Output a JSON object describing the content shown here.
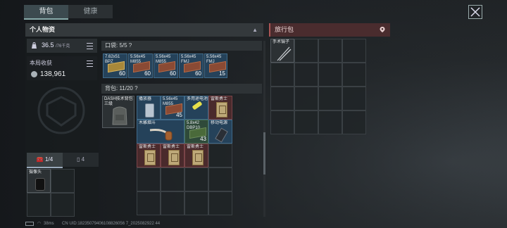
{
  "tabs": {
    "backpack": "背包",
    "health": "健康"
  },
  "personal": {
    "title": "个人物资"
  },
  "travel": {
    "title": "旅行包",
    "items": [
      {
        "label": "手术镊子"
      }
    ]
  },
  "weight": {
    "value": "36.5",
    "max": "/76千克"
  },
  "earnings": {
    "label": "本局收获",
    "value": "138,961"
  },
  "pocket": {
    "title": "口袋: 5/5  ?",
    "items": [
      {
        "label": "7.62x51\nBPZ",
        "count": "60"
      },
      {
        "label": "5.56x45\nM855",
        "count": "60"
      },
      {
        "label": "5.56x45\nM855",
        "count": "60"
      },
      {
        "label": "5.56x45\nFMJ",
        "count": "60"
      },
      {
        "label": "5.56x45\nFMJ",
        "count": "15"
      }
    ]
  },
  "backpack": {
    "title": "背包: 11/20  ?",
    "bag_label": "DASH技术背包\n三级",
    "items": [
      {
        "label": "播放器"
      },
      {
        "label": "5.56x45\nM855",
        "count": "45"
      },
      {
        "label": "多用途电池"
      },
      {
        "label": "雷斯勇士"
      },
      {
        "label": "木雕烟斗"
      },
      {
        "label": "5.8x42\nDBP10",
        "count": "43"
      },
      {
        "label": "移动电源"
      },
      {
        "label": "雷斯勇士"
      },
      {
        "label": "雷斯勇士"
      },
      {
        "label": "雷斯勇士"
      }
    ]
  },
  "bottom_tabs": {
    "a": "1/4",
    "b": "4"
  },
  "slot": {
    "label": "摄像头"
  },
  "status": {
    "ping": "38ms",
    "uid": "CN UID:18235079406108826056 7_2025082922 44"
  }
}
